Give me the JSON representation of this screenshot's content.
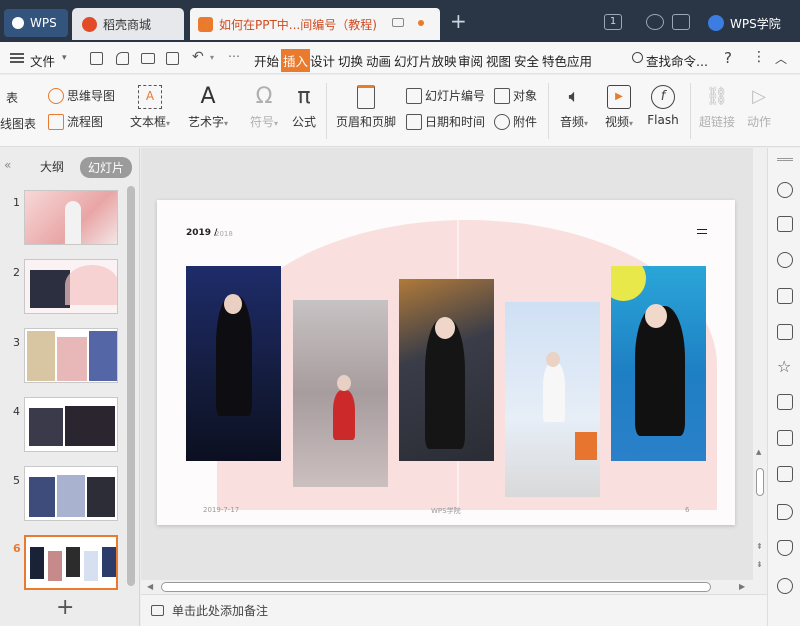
{
  "tabs": {
    "wps": "WPS",
    "store": "稻壳商城",
    "document": "如何在PPT中...间编号（教程)",
    "count": "1",
    "academy": "WPS学院"
  },
  "menu": {
    "file": "文件",
    "items": [
      "开始",
      "插入",
      "设计",
      "切换",
      "动画",
      "幻灯片放映",
      "审阅",
      "视图",
      "安全",
      "特色应用"
    ],
    "search": "查找命令..."
  },
  "ribbon": {
    "mindmap": "思维导图",
    "flowchart": "流程图",
    "chart_partial_1": "表",
    "chart_partial_2": "线图表",
    "textbox": "文本框",
    "art": "艺术字",
    "symbol": "符号",
    "formula": "公式",
    "header_footer": "页眉和页脚",
    "slide_number": "幻灯片编号",
    "object": "对象",
    "datetime": "日期和时间",
    "attachment": "附件",
    "audio": "音频",
    "video": "视频",
    "flash": "Flash",
    "hyperlink": "超链接",
    "action": "动作"
  },
  "panel": {
    "outline": "大纲",
    "slides": "幻灯片",
    "slide_numbers": [
      "1",
      "2",
      "3",
      "4",
      "5",
      "6"
    ],
    "active_slide": 6
  },
  "slide": {
    "year": "2019 /",
    "year_sub": "2018",
    "date": "2019-7-17",
    "brand": "WPS学院",
    "page": "6"
  },
  "notes": "单击此处添加备注",
  "colors": {
    "accent": "#e97a2e",
    "titlebar": "#2a3646"
  }
}
